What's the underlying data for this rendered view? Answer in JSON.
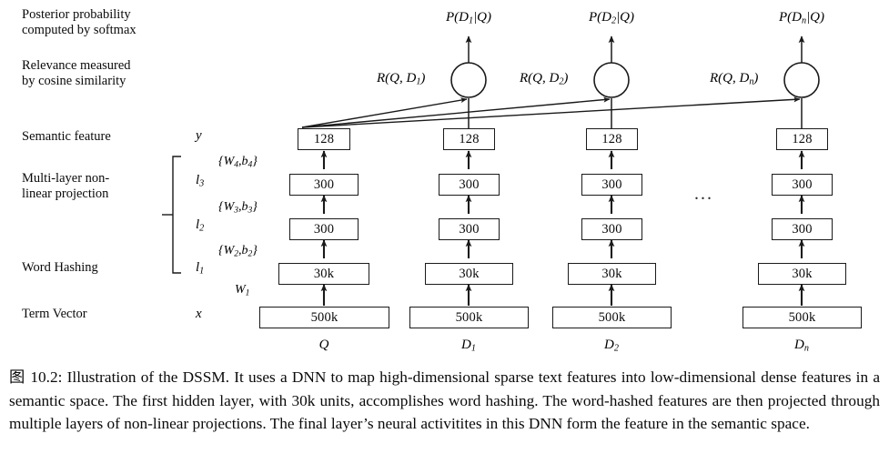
{
  "figure": {
    "left_labels": [
      {
        "id": "posterior",
        "text": "Posterior probability\ncomputed by softmax"
      },
      {
        "id": "relevance",
        "text": "Relevance measured\nby cosine similarity"
      },
      {
        "id": "semantic-feature",
        "text": "Semantic feature"
      },
      {
        "id": "multilayer",
        "text": "Multi-layer non-\nlinear projection"
      },
      {
        "id": "word-hashing",
        "text": "Word Hashing"
      },
      {
        "id": "term-vector",
        "text": "Term Vector"
      }
    ],
    "layer_symbols": {
      "y": "y",
      "l3": "l",
      "l3_sub": "3",
      "l2": "l",
      "l2_sub": "2",
      "l1": "l",
      "l1_sub": "1",
      "x": "x"
    },
    "weight_labels": [
      {
        "id": "w4",
        "main": "{W",
        "sub1": "4",
        "mid": ",b",
        "sub2": "4",
        "close": "}"
      },
      {
        "id": "w3",
        "main": "{W",
        "sub1": "3",
        "mid": ",b",
        "sub2": "3",
        "close": "}"
      },
      {
        "id": "w2",
        "main": "{W",
        "sub1": "2",
        "mid": ",b",
        "sub2": "2",
        "close": "}"
      },
      {
        "id": "w1",
        "main": "W",
        "sub1": "1",
        "mid": "",
        "sub2": "",
        "close": ""
      }
    ],
    "w1_label": "W",
    "w1_sub": "1",
    "columns": [
      {
        "id": "query",
        "name": "Q",
        "name_sub": "",
        "top_label": "",
        "top_label_sub": "",
        "relevance_label": "",
        "relevance_sub": "",
        "has_circle": false,
        "layers": [
          "128",
          "300",
          "300",
          "30k",
          "500k"
        ]
      },
      {
        "id": "doc1",
        "name": "D",
        "name_sub": "1",
        "top_label": "P(D",
        "top_label_sub": "1",
        "top_label_tail": "|Q)",
        "relevance_label": "R(Q, D",
        "relevance_sub": "1",
        "relevance_tail": ")",
        "has_circle": true,
        "layers": [
          "128",
          "300",
          "300",
          "30k",
          "500k"
        ]
      },
      {
        "id": "doc2",
        "name": "D",
        "name_sub": "2",
        "top_label": "P(D",
        "top_label_sub": "2",
        "top_label_tail": "|Q)",
        "relevance_label": "R(Q, D",
        "relevance_sub": "2",
        "relevance_tail": ")",
        "has_circle": true,
        "layers": [
          "128",
          "300",
          "300",
          "30k",
          "500k"
        ]
      },
      {
        "id": "docn",
        "name": "D",
        "name_sub": "n",
        "top_label": "P(D",
        "top_label_sub": "n",
        "top_label_tail": "|Q)",
        "relevance_label": "R(Q, D",
        "relevance_sub": "n",
        "relevance_tail": ")",
        "has_circle": true,
        "layers": [
          "128",
          "300",
          "300",
          "30k",
          "500k"
        ]
      }
    ],
    "ellipsis": "...",
    "colors": {
      "ink": "#0a0a0a",
      "line": "#1a1a1a",
      "background": "#ffffff"
    }
  },
  "caption": {
    "number": "图 10.2:",
    "text": " Illustration of the DSSM. It uses a DNN to map high-dimensional sparse text features into low-dimensional dense features in a semantic space.  The first hidden layer, with 30k units, accomplishes word hashing.  The word-hashed features are then projected through multiple layers of non-linear projections. The final layer’s neural activitites in this DNN form the feature in the semantic space."
  }
}
